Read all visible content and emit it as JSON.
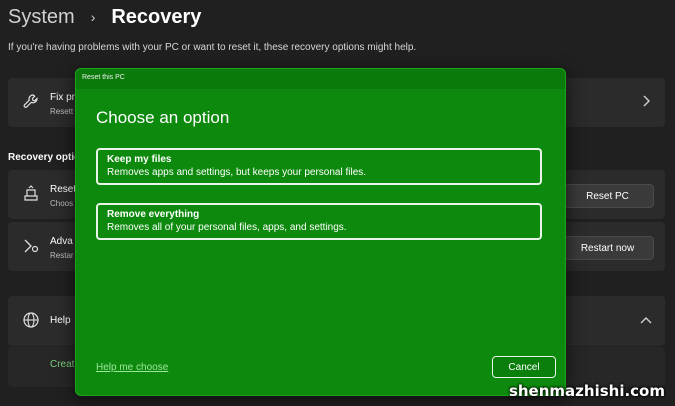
{
  "breadcrumb": {
    "parent": "System",
    "separator": "›",
    "current": "Recovery"
  },
  "page_description": "If you're having problems with your PC or want to reset it, these recovery options might help.",
  "cards": {
    "fix": {
      "icon": "wrench-icon",
      "title": "Fix pr",
      "subtitle": "Resett"
    },
    "section_label": "Recovery optio",
    "reset": {
      "icon": "reset-pc-icon",
      "title": "Reset",
      "subtitle": "Choos",
      "button": "Reset PC"
    },
    "advanced": {
      "icon": "advanced-startup-icon",
      "title": "Adva",
      "subtitle": "Restar",
      "button": "Restart now"
    },
    "help": {
      "icon": "globe-icon",
      "title": "Help"
    },
    "help_link": "Creat"
  },
  "dialog": {
    "title": "Reset this PC",
    "heading": "Choose an option",
    "options": [
      {
        "title": "Keep my files",
        "description": "Removes apps and settings, but keeps your personal files."
      },
      {
        "title": "Remove everything",
        "description": "Removes all of your personal files, apps, and settings."
      }
    ],
    "help_link": "Help me choose",
    "cancel": "Cancel"
  },
  "watermark": "shenmazhishi.com",
  "colors": {
    "dialog_bg": "#0d8a0d",
    "page_bg": "#202020",
    "card_bg": "#2b2b2b"
  }
}
